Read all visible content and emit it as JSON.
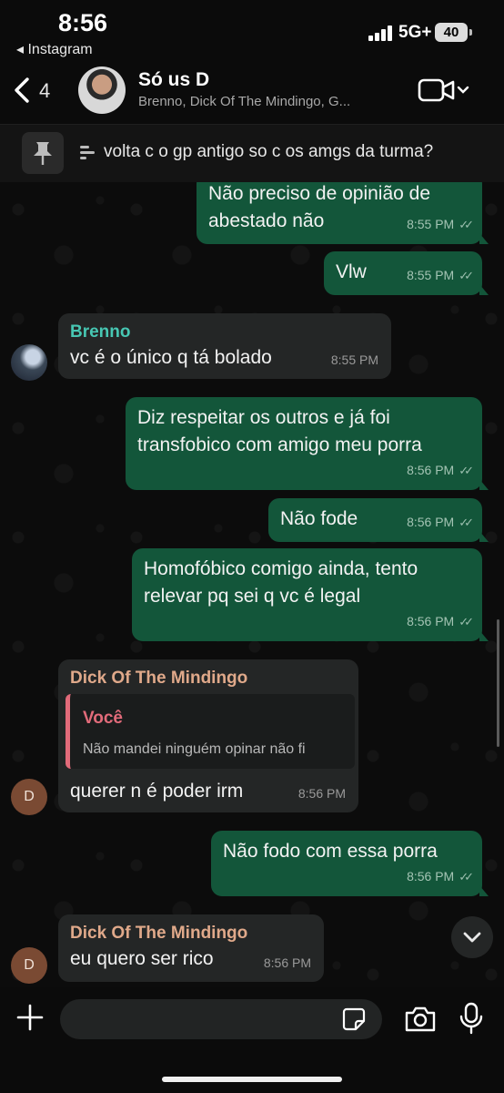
{
  "status_bar": {
    "time": "8:56",
    "back_app": "◂ Instagram",
    "network": "5G+",
    "battery": "40"
  },
  "header": {
    "back_count": "4",
    "title": "Só us D",
    "members": "Brenno, Dick Of The Mindingo, G..."
  },
  "pinned": {
    "text": "volta c o gp antigo so c os amgs da turma?"
  },
  "messages": [
    {
      "lines": [
        "Não preciso de opinião de",
        "abestado não"
      ],
      "time": "8:55 PM"
    },
    {
      "lines": [
        "Vlw"
      ],
      "time": "8:55 PM"
    },
    {
      "sender": "Brenno",
      "sender_color": "#47c7b3",
      "lines": [
        "vc é o único q tá bolado"
      ],
      "time": "8:55 PM"
    },
    {
      "lines": [
        "Diz respeitar os outros e já foi",
        "transfobico com amigo meu porra"
      ],
      "time": "8:56 PM"
    },
    {
      "lines": [
        "Não fode"
      ],
      "time": "8:56 PM"
    },
    {
      "lines": [
        "Homofóbico comigo ainda, tento",
        "relevar pq sei q vc é legal"
      ],
      "time": "8:56 PM"
    },
    {
      "sender": "Dick Of The Mindingo",
      "sender_color": "#e0a98a",
      "avatar_letter": "D",
      "quote": {
        "name": "Você",
        "text": "Não mandei ninguém opinar não fi"
      },
      "lines": [
        "querer n é poder irm"
      ],
      "time": "8:56 PM"
    },
    {
      "lines": [
        "Não fodo com essa porra"
      ],
      "time": "8:56 PM"
    },
    {
      "sender": "Dick Of The Mindingo",
      "sender_color": "#e0a98a",
      "avatar_letter": "D",
      "lines": [
        "eu quero ser rico"
      ],
      "time": "8:56 PM"
    }
  ],
  "composer": {
    "placeholder": ""
  },
  "colors": {
    "outgoing_bubble": "#13563a",
    "incoming_bubble": "#242626",
    "quote_accent": "#e26b7a",
    "avatar_d": "#7a4a33"
  }
}
